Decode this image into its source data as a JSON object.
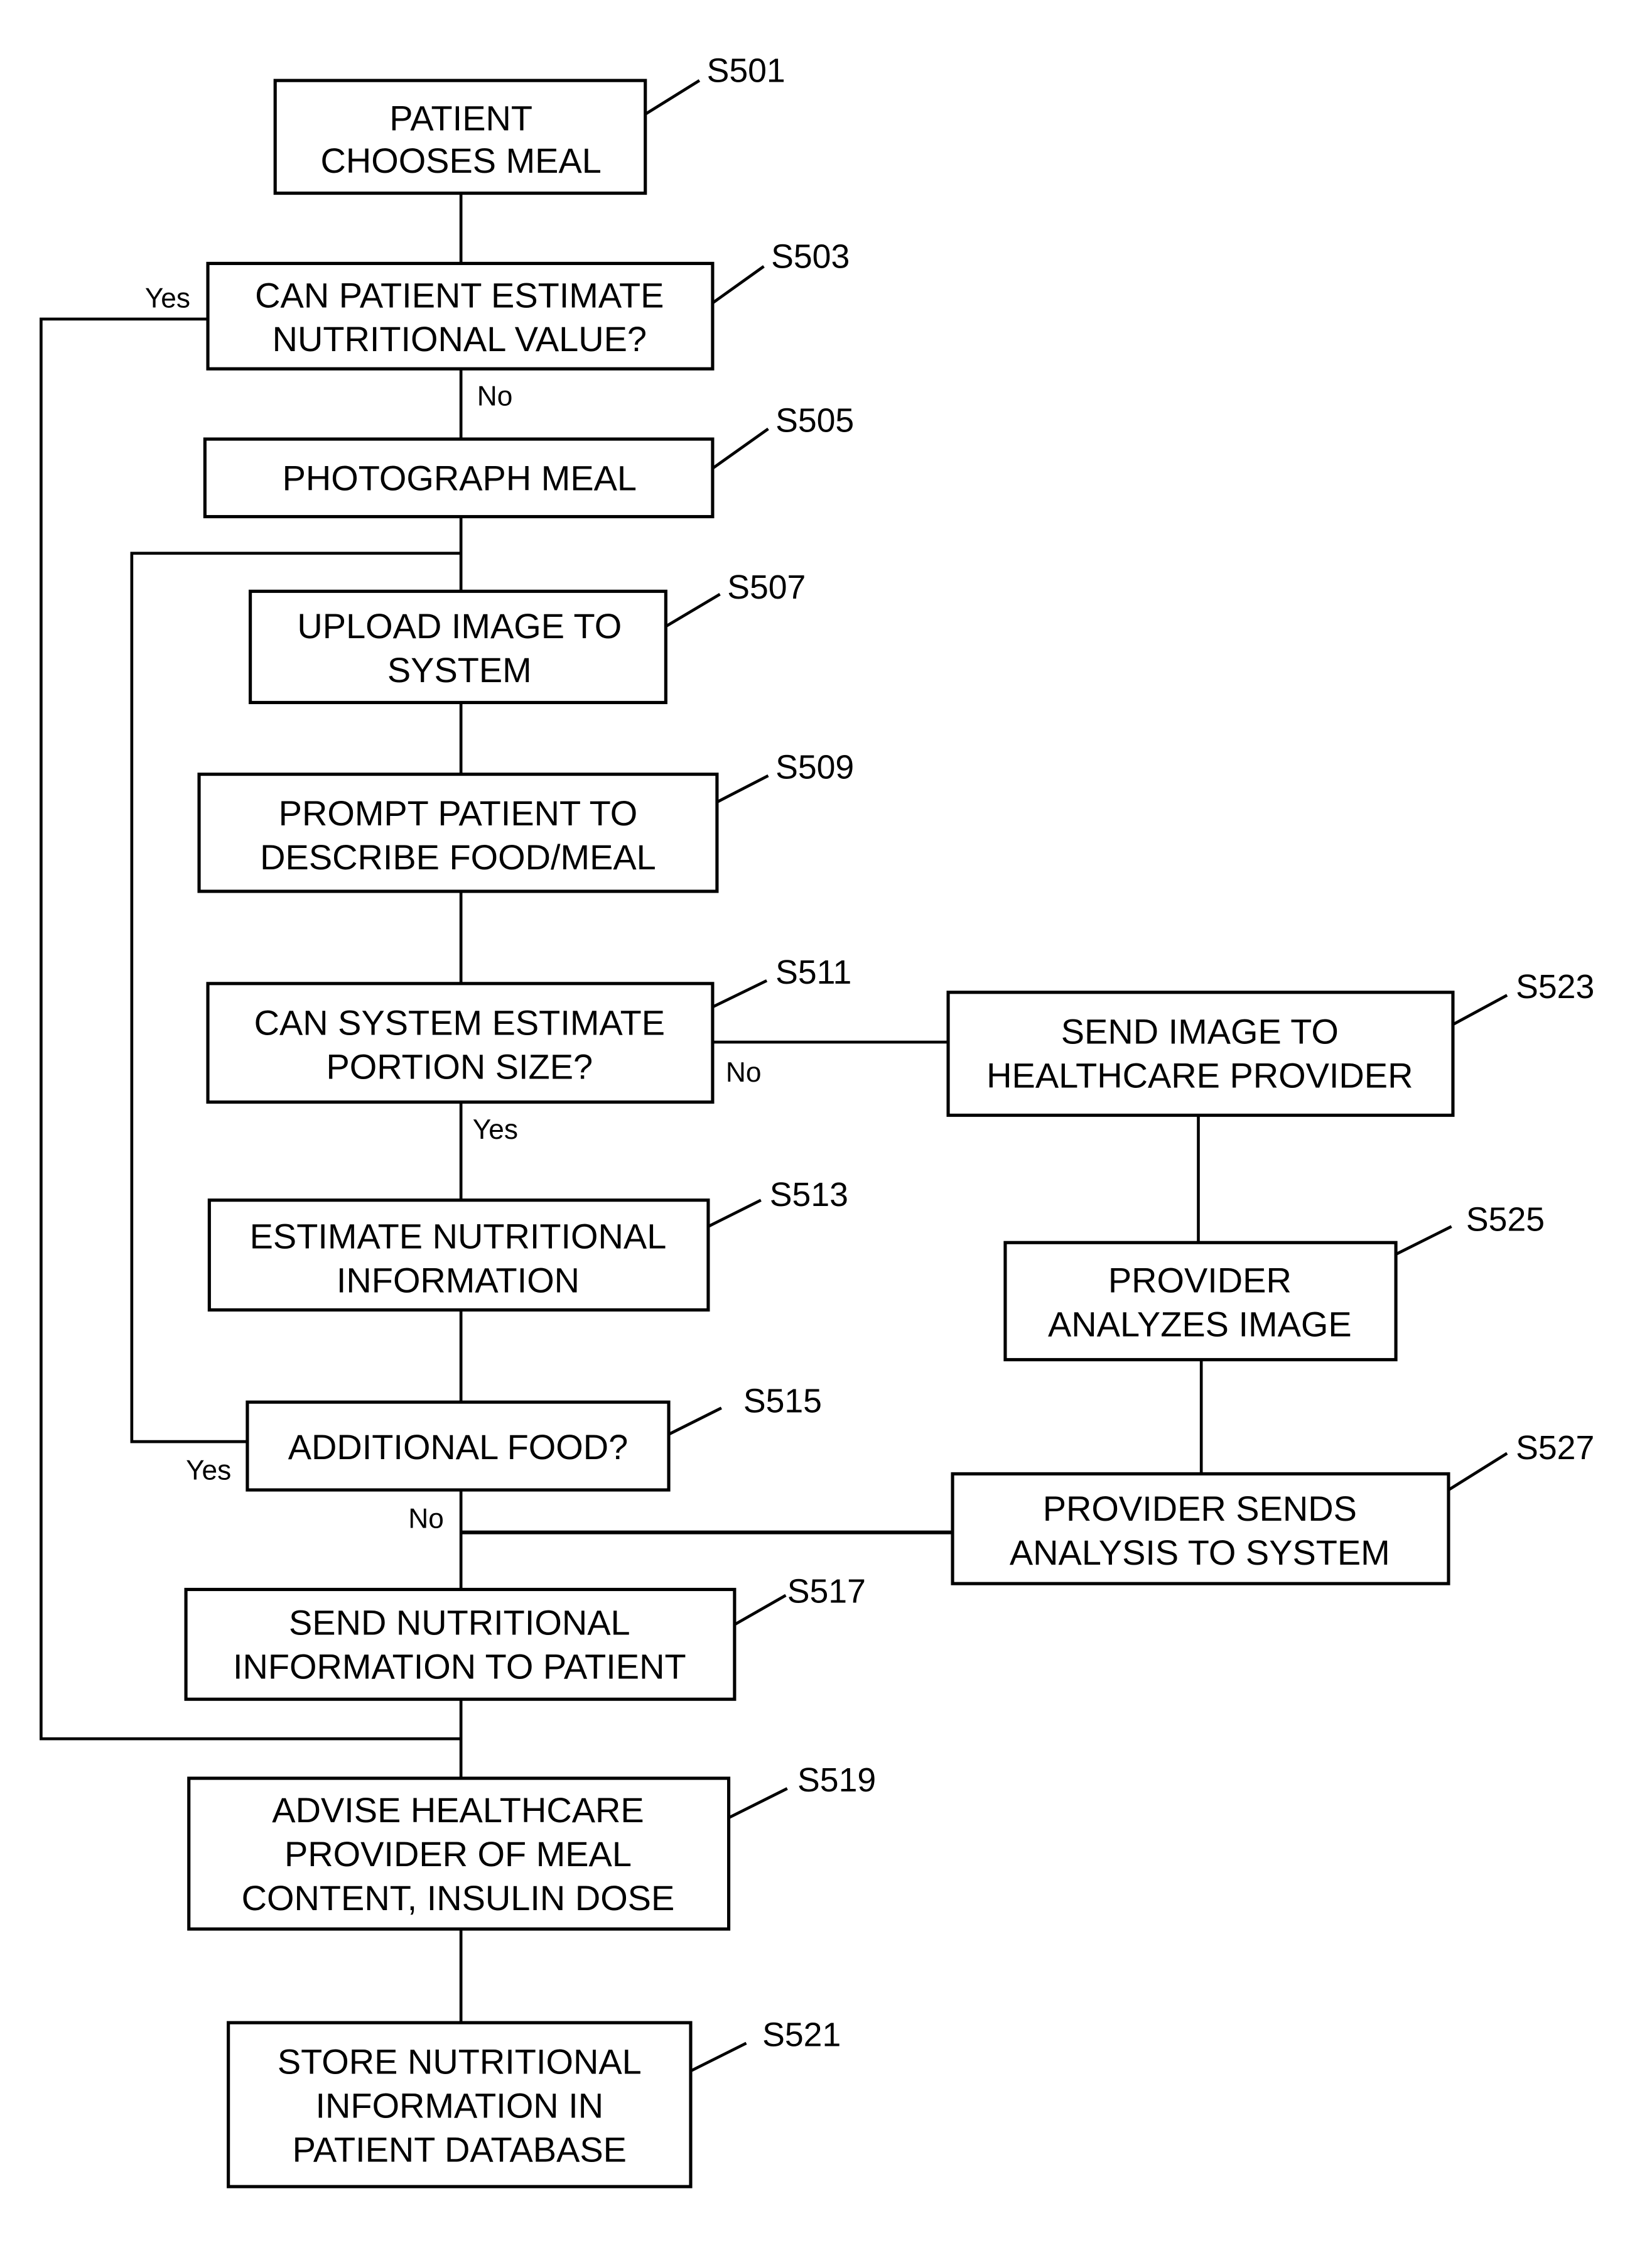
{
  "figure": {
    "type": "flowchart",
    "steps": [
      {
        "id": "S501",
        "lines": [
          "PATIENT",
          "CHOOSES MEAL"
        ]
      },
      {
        "id": "S503",
        "lines": [
          "CAN PATIENT ESTIMATE",
          "NUTRITIONAL VALUE?"
        ],
        "decision": true
      },
      {
        "id": "S505",
        "lines": [
          "PHOTOGRAPH MEAL"
        ]
      },
      {
        "id": "S507",
        "lines": [
          "UPLOAD IMAGE TO",
          "SYSTEM"
        ]
      },
      {
        "id": "S509",
        "lines": [
          "PROMPT PATIENT TO",
          "DESCRIBE FOOD/MEAL"
        ]
      },
      {
        "id": "S511",
        "lines": [
          "CAN SYSTEM ESTIMATE",
          "PORTION SIZE?"
        ],
        "decision": true
      },
      {
        "id": "S513",
        "lines": [
          "ESTIMATE NUTRITIONAL",
          "INFORMATION"
        ]
      },
      {
        "id": "S515",
        "lines": [
          "ADDITIONAL FOOD?"
        ],
        "decision": true
      },
      {
        "id": "S517",
        "lines": [
          "SEND NUTRITIONAL",
          "INFORMATION TO PATIENT"
        ]
      },
      {
        "id": "S519",
        "lines": [
          "ADVISE HEALTHCARE",
          "PROVIDER OF MEAL",
          "CONTENT, INSULIN DOSE"
        ]
      },
      {
        "id": "S521",
        "lines": [
          "STORE NUTRITIONAL",
          "INFORMATION IN",
          "PATIENT DATABASE"
        ]
      },
      {
        "id": "S523",
        "lines": [
          "SEND IMAGE TO",
          "HEALTHCARE PROVIDER"
        ]
      },
      {
        "id": "S525",
        "lines": [
          "PROVIDER",
          "ANALYZES IMAGE"
        ]
      },
      {
        "id": "S527",
        "lines": [
          "PROVIDER SENDS",
          "ANALYSIS TO SYSTEM"
        ]
      }
    ],
    "branch_labels": {
      "s503_yes": "Yes",
      "s503_no": "No",
      "s511_no": "No",
      "s511_yes": "Yes",
      "s515_yes": "Yes",
      "s515_no": "No"
    },
    "edges": [
      {
        "from": "S501",
        "to": "S503"
      },
      {
        "from": "S503",
        "to": "S505",
        "label": "No"
      },
      {
        "from": "S503",
        "to": "S519",
        "label": "Yes"
      },
      {
        "from": "S505",
        "to": "S507"
      },
      {
        "from": "S507",
        "to": "S509"
      },
      {
        "from": "S509",
        "to": "S511"
      },
      {
        "from": "S511",
        "to": "S513",
        "label": "Yes"
      },
      {
        "from": "S511",
        "to": "S523",
        "label": "No"
      },
      {
        "from": "S513",
        "to": "S515"
      },
      {
        "from": "S515",
        "to": "S507",
        "label": "Yes"
      },
      {
        "from": "S515",
        "to": "S517",
        "label": "No"
      },
      {
        "from": "S523",
        "to": "S525"
      },
      {
        "from": "S525",
        "to": "S527"
      },
      {
        "from": "S527",
        "to": "S517"
      },
      {
        "from": "S517",
        "to": "S519"
      },
      {
        "from": "S519",
        "to": "S521"
      }
    ]
  }
}
